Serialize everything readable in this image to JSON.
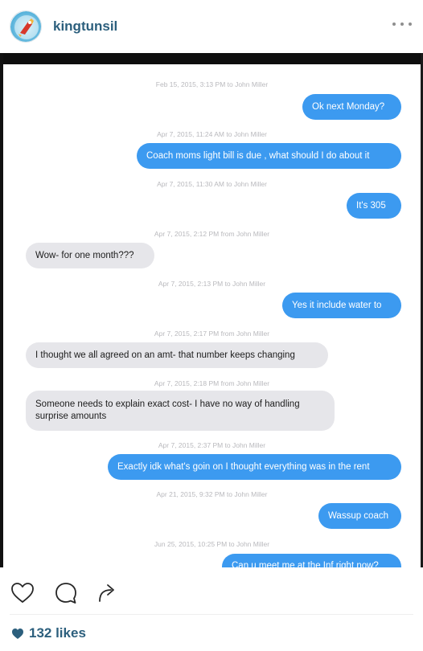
{
  "header": {
    "username": "kingtunsil",
    "more_icon": "more-horizontal-icon"
  },
  "conversation": {
    "messages": [
      {
        "timestamp": "Feb 15, 2015, 3:13 PM to John Miller",
        "direction": "out",
        "text": "Ok next Monday?"
      },
      {
        "timestamp": "Apr 7, 2015, 11:24 AM to John Miller",
        "direction": "out",
        "text": "Coach moms light bill is due , what should I do about it"
      },
      {
        "timestamp": "Apr 7, 2015, 11:30 AM to John Miller",
        "direction": "out",
        "text": "It's 305"
      },
      {
        "timestamp": "Apr 7, 2015, 2:12 PM from John Miller",
        "direction": "in",
        "text": "Wow- for one month???"
      },
      {
        "timestamp": "Apr 7, 2015, 2:13 PM to John Miller",
        "direction": "out",
        "text": "Yes it include water to"
      },
      {
        "timestamp": "Apr 7, 2015, 2:17 PM from John Miller",
        "direction": "in",
        "text": "I thought we all agreed on an amt- that number keeps changing"
      },
      {
        "timestamp": "Apr 7, 2015, 2:18 PM from John Miller",
        "direction": "in",
        "text": "Someone needs to explain exact cost- I have no way of handling surprise amounts"
      },
      {
        "timestamp": "Apr 7, 2015, 2:37 PM to John Miller",
        "direction": "out",
        "text": "Exactly idk what's goin on I thought everything was in the rent"
      },
      {
        "timestamp": "Apr 21, 2015, 9:32 PM to John Miller",
        "direction": "out",
        "text": "Wassup coach"
      },
      {
        "timestamp": "Jun 25, 2015, 10:25 PM to John Miller",
        "direction": "out",
        "text": "Can u meet me at the Inf right now?"
      }
    ]
  },
  "actions": {
    "like_icon": "heart-outline-icon",
    "comment_icon": "comment-icon",
    "share_icon": "share-arrow-icon"
  },
  "likes": {
    "icon": "heart-filled-icon",
    "label": "132 likes"
  },
  "colors": {
    "username": "#2c5f7d",
    "outgoing_bubble": "#3c9af0",
    "incoming_bubble": "#e6e6ea",
    "timestamp": "#b9b9bd"
  }
}
